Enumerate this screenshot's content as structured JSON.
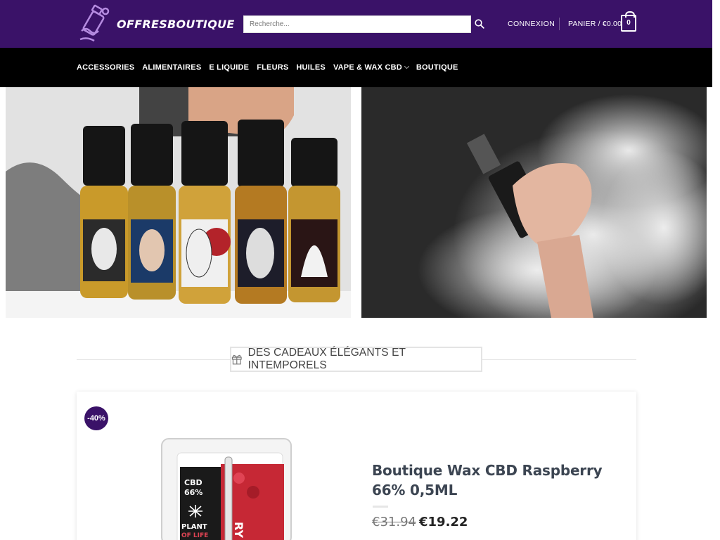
{
  "header": {
    "brand": "OFFRESBOUTIQUE",
    "search_placeholder": "Recherche...",
    "login_label": "CONNEXION",
    "cart_label": "PANIER / €0.00",
    "cart_count": "0",
    "bg_color": "#3a1268"
  },
  "nav": {
    "items": [
      {
        "label": "ACCESSORIES"
      },
      {
        "label": "ALIMENTAIRES"
      },
      {
        "label": "E LIQUIDE"
      },
      {
        "label": "FLEURS"
      },
      {
        "label": "HUILES"
      },
      {
        "label": "VAPE & WAX CBD"
      },
      {
        "label": "BOUTIQUE"
      }
    ]
  },
  "hero": {
    "left_image": "e-liquid-bottles-image",
    "right_image": "vape-smoke-image"
  },
  "section": {
    "title": "DES CADEAUX ÉLÉGANTS ET INTEMPORELS",
    "icon": "gift-icon"
  },
  "featured": {
    "badge": "-40%",
    "title": "Boutique Wax CBD Raspberry 66% 0,5ML",
    "price_old": "€31.94",
    "price_new": "€19.22",
    "package_text_1": "CBD",
    "package_text_2": "66%",
    "package_text_3": "PLANT",
    "package_text_4": "OF LIFE",
    "package_text_5": "RY"
  }
}
